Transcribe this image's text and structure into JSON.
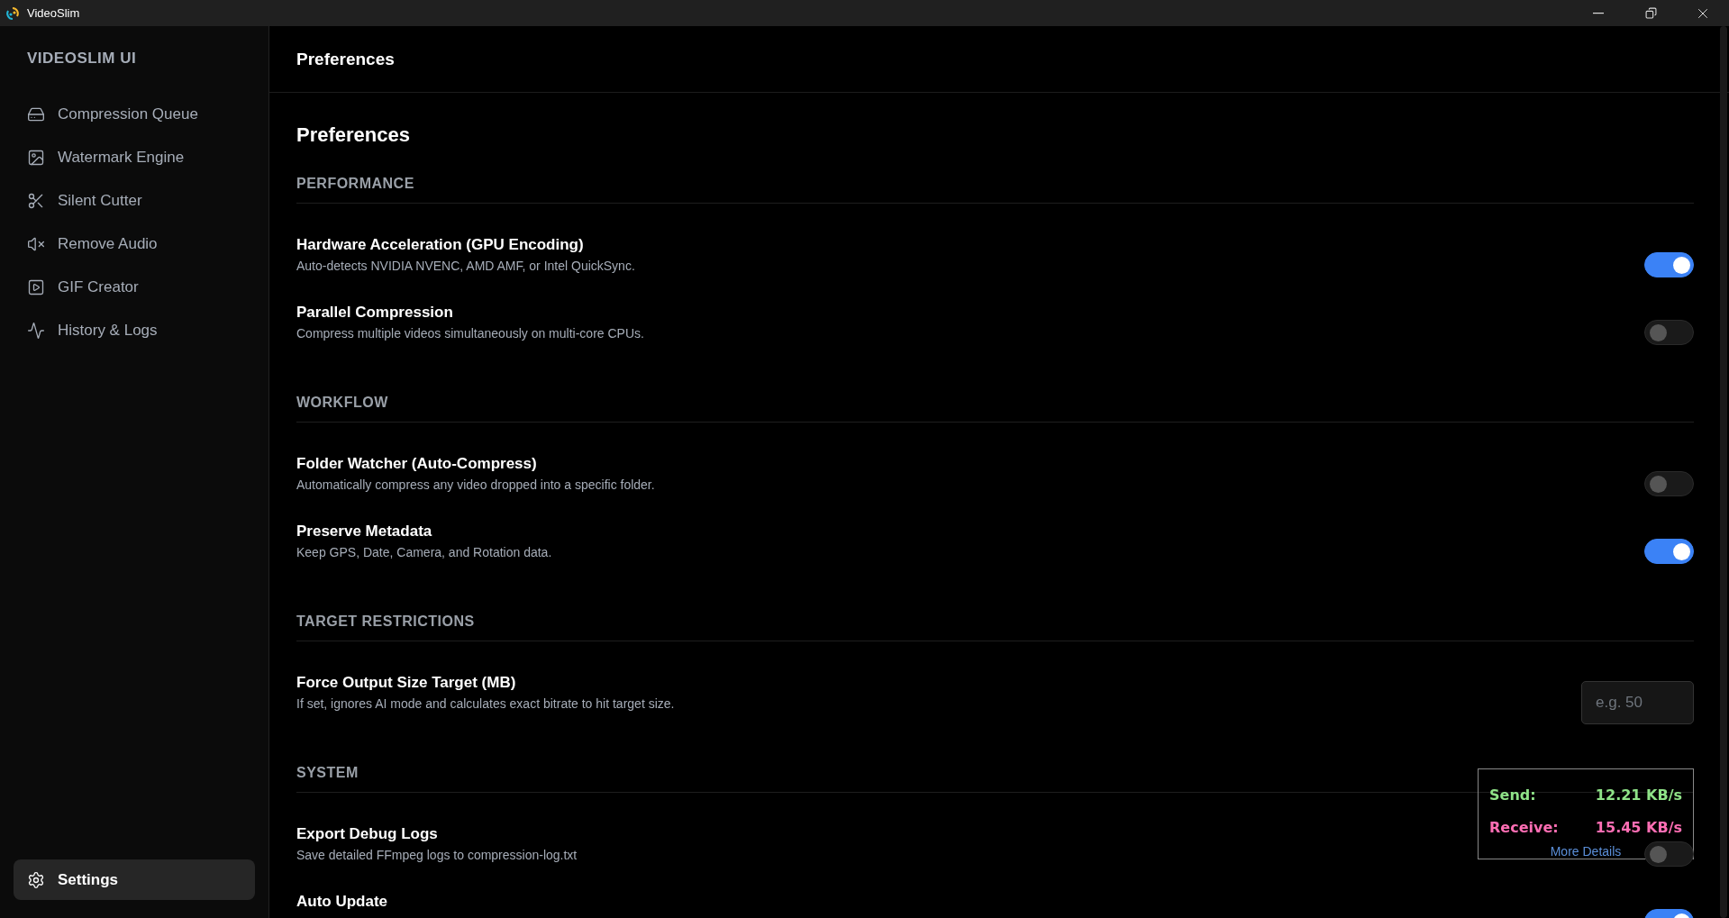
{
  "window": {
    "title": "VideoSlim"
  },
  "sidebar": {
    "brand": "VIDEOSLIM UI",
    "items": [
      {
        "label": "Compression Queue",
        "selected": false
      },
      {
        "label": "Watermark Engine",
        "selected": false
      },
      {
        "label": "Silent Cutter",
        "selected": false
      },
      {
        "label": "Remove Audio",
        "selected": false
      },
      {
        "label": "GIF Creator",
        "selected": false
      },
      {
        "label": "History & Logs",
        "selected": false
      }
    ],
    "footer_item": {
      "label": "Settings",
      "selected": true
    }
  },
  "header": {
    "title": "Preferences"
  },
  "page": {
    "title": "Preferences",
    "sections": [
      {
        "heading": "PERFORMANCE",
        "rows": [
          {
            "kind": "toggle",
            "title": "Hardware Acceleration (GPU Encoding)",
            "description": "Auto-detects NVIDIA NVENC, AMD AMF, or Intel QuickSync.",
            "on": true
          },
          {
            "kind": "toggle",
            "title": "Parallel Compression",
            "description": "Compress multiple videos simultaneously on multi-core CPUs.",
            "on": false
          }
        ]
      },
      {
        "heading": "WORKFLOW",
        "rows": [
          {
            "kind": "toggle",
            "title": "Folder Watcher (Auto-Compress)",
            "description": "Automatically compress any video dropped into a specific folder.",
            "on": false
          },
          {
            "kind": "toggle",
            "title": "Preserve Metadata",
            "description": "Keep GPS, Date, Camera, and Rotation data.",
            "on": true
          }
        ]
      },
      {
        "heading": "TARGET RESTRICTIONS",
        "rows": [
          {
            "kind": "input",
            "title": "Force Output Size Target (MB)",
            "description": "If set, ignores AI mode and calculates exact bitrate to hit target size.",
            "placeholder": "e.g. 50"
          }
        ]
      },
      {
        "heading": "SYSTEM",
        "rows": [
          {
            "kind": "toggle",
            "title": "Export Debug Logs",
            "description": "Save detailed FFmpeg logs to compression-log.txt",
            "on": false
          },
          {
            "kind": "toggle",
            "title": "Auto Update",
            "on": true
          }
        ]
      }
    ]
  },
  "network_overlay": {
    "send_label": "Send:",
    "send_value": "12.21 KB/s",
    "receive_label": "Receive:",
    "receive_value": "15.45 KB/s",
    "link": "More Details"
  }
}
